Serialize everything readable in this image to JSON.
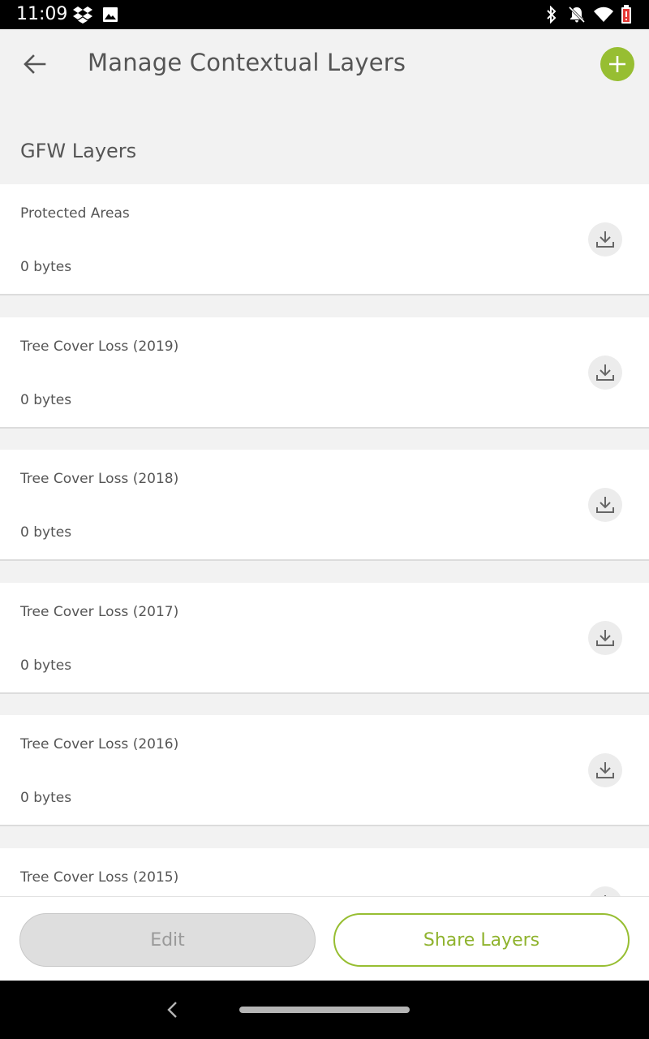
{
  "status_bar": {
    "time": "11:09",
    "left_icons": [
      "dropbox-icon",
      "image-icon"
    ],
    "right_icons": [
      "bluetooth-icon",
      "notifications-off-icon",
      "wifi-icon",
      "battery-low-icon"
    ]
  },
  "app_bar": {
    "title": "Manage Contextual Layers",
    "back_icon": "arrow-back-icon",
    "add_icon": "plus-icon"
  },
  "section": {
    "title": "GFW Layers"
  },
  "layers": [
    {
      "name": "Protected Areas",
      "size": "0 bytes"
    },
    {
      "name": "Tree Cover Loss (2019)",
      "size": "0 bytes"
    },
    {
      "name": "Tree Cover Loss (2018)",
      "size": "0 bytes"
    },
    {
      "name": "Tree Cover Loss (2017)",
      "size": "0 bytes"
    },
    {
      "name": "Tree Cover Loss (2016)",
      "size": "0 bytes"
    },
    {
      "name": "Tree Cover Loss (2015)",
      "size": ""
    }
  ],
  "actions": {
    "edit_label": "Edit",
    "share_label": "Share Layers"
  },
  "colors": {
    "accent": "#97be32",
    "text": "#555555",
    "background": "#f2f2f2",
    "card": "#ffffff"
  }
}
